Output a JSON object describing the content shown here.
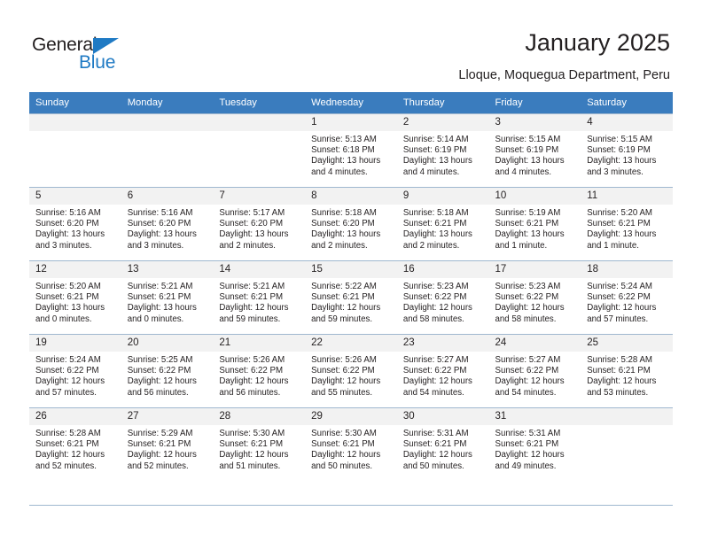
{
  "brand": {
    "name_part1": "General",
    "name_part2": "Blue",
    "accent_color": "#1f7ac4"
  },
  "header": {
    "title": "January 2025",
    "subtitle": "Lloque, Moquegua Department, Peru"
  },
  "calendar": {
    "header_bg": "#3a7cbe",
    "daynum_bg": "#f2f2f2",
    "border_color": "#9fb7cf",
    "weekday_headers": [
      "Sunday",
      "Monday",
      "Tuesday",
      "Wednesday",
      "Thursday",
      "Friday",
      "Saturday"
    ],
    "weeks": [
      [
        {
          "day": "",
          "sunrise": "",
          "sunset": "",
          "daylight1": "",
          "daylight2": "",
          "empty": true
        },
        {
          "day": "",
          "sunrise": "",
          "sunset": "",
          "daylight1": "",
          "daylight2": "",
          "empty": true
        },
        {
          "day": "",
          "sunrise": "",
          "sunset": "",
          "daylight1": "",
          "daylight2": "",
          "empty": true
        },
        {
          "day": "1",
          "sunrise": "Sunrise: 5:13 AM",
          "sunset": "Sunset: 6:18 PM",
          "daylight1": "Daylight: 13 hours",
          "daylight2": "and 4 minutes."
        },
        {
          "day": "2",
          "sunrise": "Sunrise: 5:14 AM",
          "sunset": "Sunset: 6:19 PM",
          "daylight1": "Daylight: 13 hours",
          "daylight2": "and 4 minutes."
        },
        {
          "day": "3",
          "sunrise": "Sunrise: 5:15 AM",
          "sunset": "Sunset: 6:19 PM",
          "daylight1": "Daylight: 13 hours",
          "daylight2": "and 4 minutes."
        },
        {
          "day": "4",
          "sunrise": "Sunrise: 5:15 AM",
          "sunset": "Sunset: 6:19 PM",
          "daylight1": "Daylight: 13 hours",
          "daylight2": "and 3 minutes."
        }
      ],
      [
        {
          "day": "5",
          "sunrise": "Sunrise: 5:16 AM",
          "sunset": "Sunset: 6:20 PM",
          "daylight1": "Daylight: 13 hours",
          "daylight2": "and 3 minutes."
        },
        {
          "day": "6",
          "sunrise": "Sunrise: 5:16 AM",
          "sunset": "Sunset: 6:20 PM",
          "daylight1": "Daylight: 13 hours",
          "daylight2": "and 3 minutes."
        },
        {
          "day": "7",
          "sunrise": "Sunrise: 5:17 AM",
          "sunset": "Sunset: 6:20 PM",
          "daylight1": "Daylight: 13 hours",
          "daylight2": "and 2 minutes."
        },
        {
          "day": "8",
          "sunrise": "Sunrise: 5:18 AM",
          "sunset": "Sunset: 6:20 PM",
          "daylight1": "Daylight: 13 hours",
          "daylight2": "and 2 minutes."
        },
        {
          "day": "9",
          "sunrise": "Sunrise: 5:18 AM",
          "sunset": "Sunset: 6:21 PM",
          "daylight1": "Daylight: 13 hours",
          "daylight2": "and 2 minutes."
        },
        {
          "day": "10",
          "sunrise": "Sunrise: 5:19 AM",
          "sunset": "Sunset: 6:21 PM",
          "daylight1": "Daylight: 13 hours",
          "daylight2": "and 1 minute."
        },
        {
          "day": "11",
          "sunrise": "Sunrise: 5:20 AM",
          "sunset": "Sunset: 6:21 PM",
          "daylight1": "Daylight: 13 hours",
          "daylight2": "and 1 minute."
        }
      ],
      [
        {
          "day": "12",
          "sunrise": "Sunrise: 5:20 AM",
          "sunset": "Sunset: 6:21 PM",
          "daylight1": "Daylight: 13 hours",
          "daylight2": "and 0 minutes."
        },
        {
          "day": "13",
          "sunrise": "Sunrise: 5:21 AM",
          "sunset": "Sunset: 6:21 PM",
          "daylight1": "Daylight: 13 hours",
          "daylight2": "and 0 minutes."
        },
        {
          "day": "14",
          "sunrise": "Sunrise: 5:21 AM",
          "sunset": "Sunset: 6:21 PM",
          "daylight1": "Daylight: 12 hours",
          "daylight2": "and 59 minutes."
        },
        {
          "day": "15",
          "sunrise": "Sunrise: 5:22 AM",
          "sunset": "Sunset: 6:21 PM",
          "daylight1": "Daylight: 12 hours",
          "daylight2": "and 59 minutes."
        },
        {
          "day": "16",
          "sunrise": "Sunrise: 5:23 AM",
          "sunset": "Sunset: 6:22 PM",
          "daylight1": "Daylight: 12 hours",
          "daylight2": "and 58 minutes."
        },
        {
          "day": "17",
          "sunrise": "Sunrise: 5:23 AM",
          "sunset": "Sunset: 6:22 PM",
          "daylight1": "Daylight: 12 hours",
          "daylight2": "and 58 minutes."
        },
        {
          "day": "18",
          "sunrise": "Sunrise: 5:24 AM",
          "sunset": "Sunset: 6:22 PM",
          "daylight1": "Daylight: 12 hours",
          "daylight2": "and 57 minutes."
        }
      ],
      [
        {
          "day": "19",
          "sunrise": "Sunrise: 5:24 AM",
          "sunset": "Sunset: 6:22 PM",
          "daylight1": "Daylight: 12 hours",
          "daylight2": "and 57 minutes."
        },
        {
          "day": "20",
          "sunrise": "Sunrise: 5:25 AM",
          "sunset": "Sunset: 6:22 PM",
          "daylight1": "Daylight: 12 hours",
          "daylight2": "and 56 minutes."
        },
        {
          "day": "21",
          "sunrise": "Sunrise: 5:26 AM",
          "sunset": "Sunset: 6:22 PM",
          "daylight1": "Daylight: 12 hours",
          "daylight2": "and 56 minutes."
        },
        {
          "day": "22",
          "sunrise": "Sunrise: 5:26 AM",
          "sunset": "Sunset: 6:22 PM",
          "daylight1": "Daylight: 12 hours",
          "daylight2": "and 55 minutes."
        },
        {
          "day": "23",
          "sunrise": "Sunrise: 5:27 AM",
          "sunset": "Sunset: 6:22 PM",
          "daylight1": "Daylight: 12 hours",
          "daylight2": "and 54 minutes."
        },
        {
          "day": "24",
          "sunrise": "Sunrise: 5:27 AM",
          "sunset": "Sunset: 6:22 PM",
          "daylight1": "Daylight: 12 hours",
          "daylight2": "and 54 minutes."
        },
        {
          "day": "25",
          "sunrise": "Sunrise: 5:28 AM",
          "sunset": "Sunset: 6:21 PM",
          "daylight1": "Daylight: 12 hours",
          "daylight2": "and 53 minutes."
        }
      ],
      [
        {
          "day": "26",
          "sunrise": "Sunrise: 5:28 AM",
          "sunset": "Sunset: 6:21 PM",
          "daylight1": "Daylight: 12 hours",
          "daylight2": "and 52 minutes."
        },
        {
          "day": "27",
          "sunrise": "Sunrise: 5:29 AM",
          "sunset": "Sunset: 6:21 PM",
          "daylight1": "Daylight: 12 hours",
          "daylight2": "and 52 minutes."
        },
        {
          "day": "28",
          "sunrise": "Sunrise: 5:30 AM",
          "sunset": "Sunset: 6:21 PM",
          "daylight1": "Daylight: 12 hours",
          "daylight2": "and 51 minutes."
        },
        {
          "day": "29",
          "sunrise": "Sunrise: 5:30 AM",
          "sunset": "Sunset: 6:21 PM",
          "daylight1": "Daylight: 12 hours",
          "daylight2": "and 50 minutes."
        },
        {
          "day": "30",
          "sunrise": "Sunrise: 5:31 AM",
          "sunset": "Sunset: 6:21 PM",
          "daylight1": "Daylight: 12 hours",
          "daylight2": "and 50 minutes."
        },
        {
          "day": "31",
          "sunrise": "Sunrise: 5:31 AM",
          "sunset": "Sunset: 6:21 PM",
          "daylight1": "Daylight: 12 hours",
          "daylight2": "and 49 minutes."
        },
        {
          "day": "",
          "sunrise": "",
          "sunset": "",
          "daylight1": "",
          "daylight2": "",
          "empty": true
        }
      ]
    ]
  }
}
